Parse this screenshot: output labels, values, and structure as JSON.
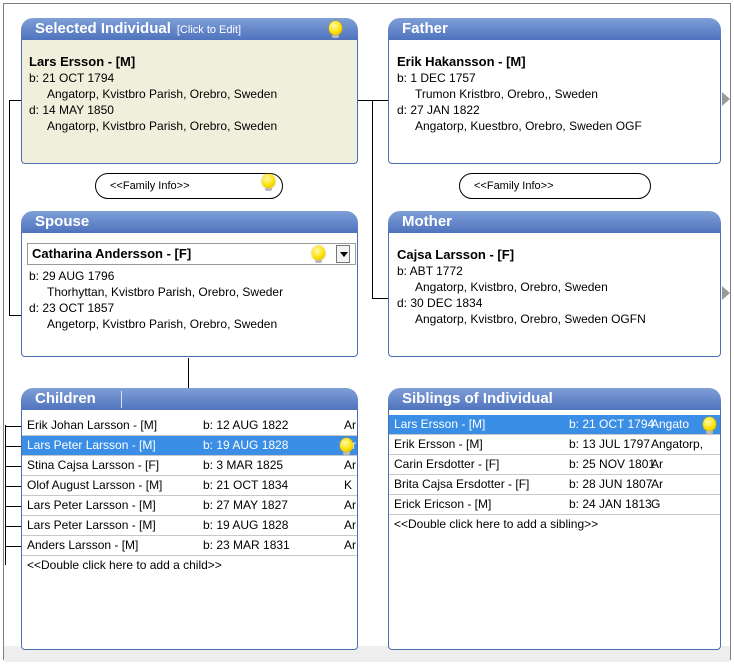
{
  "selected": {
    "title": "Selected Individual",
    "edit_label": "[Click to Edit]",
    "name": "Lars Ersson - [M]",
    "birth": "b: 21 OCT 1794",
    "birth_place": "Angatorp, Kvistbro Parish, Orebro, Sweden",
    "death": "d: 14 MAY 1850",
    "death_place": "Angatorp, Kvistbro Parish, Orebro, Sweden"
  },
  "father": {
    "title": "Father",
    "name": "Erik Hakansson - [M]",
    "birth": "b: 1 DEC 1757",
    "birth_place": "Trumon Kristbro, Orebro,, Sweden",
    "death": "d: 27 JAN 1822",
    "death_place": "Angatorp, Kuestbro, Orebro, Sweden   OGF"
  },
  "family_info_left": "<<Family Info>>",
  "family_info_right": "<<Family Info>>",
  "spouse": {
    "title": "Spouse",
    "name": "Catharina Andersson - [F]",
    "birth": "b: 29 AUG 1796",
    "birth_place": "Thorhyttan, Kvistbro Parish, Orebro, Sweder",
    "death": "d: 23 OCT 1857",
    "death_place": "Angetorp, Kvistbro Parish, Orebro, Sweden"
  },
  "mother": {
    "title": "Mother",
    "name": "Cajsa Larsson - [F]",
    "birth": "b: ABT 1772",
    "birth_place": "Angatorp, Kvistbro, Orebro, Sweden",
    "death": "d: 30 DEC 1834",
    "death_place": "Angatorp, Kvistbro, Orebro, Sweden   OGFN"
  },
  "children": {
    "title": "Children",
    "rows": [
      {
        "name": "Erik Johan Larsson - [M]",
        "birth": "b: 12 AUG 1822",
        "place": "Ar"
      },
      {
        "name": "Lars Peter Larsson - [M]",
        "birth": "b: 19 AUG 1828",
        "place": "Ar"
      },
      {
        "name": "Stina Cajsa Larsson - [F]",
        "birth": "b: 3 MAR 1825",
        "place": "Ar"
      },
      {
        "name": "Olof August Larsson - [M]",
        "birth": "b: 21 OCT 1834",
        "place": "K"
      },
      {
        "name": "Lars Peter Larsson - [M]",
        "birth": "b: 27 MAY 1827",
        "place": "Ar"
      },
      {
        "name": "Lars Peter Larsson - [M]",
        "birth": "b: 19 AUG 1828",
        "place": "Ar"
      },
      {
        "name": "Anders Larsson - [M]",
        "birth": "b: 23 MAR 1831",
        "place": "Ar"
      }
    ],
    "add_label": "<<Double click here to add a child>>"
  },
  "siblings": {
    "title": "Siblings of Individual",
    "rows": [
      {
        "name": "Lars Ersson - [M]",
        "birth": "b: 21 OCT 1794",
        "place": "Angato"
      },
      {
        "name": "Erik Ersson - [M]",
        "birth": "b: 13 JUL 1797",
        "place": "Angatorp,"
      },
      {
        "name": "Carin Ersdotter - [F]",
        "birth": "b: 25 NOV 1801",
        "place": "Ar"
      },
      {
        "name": "Brita Cajsa Ersdotter - [F]",
        "birth": "b: 28 JUN 1807",
        "place": "Ar"
      },
      {
        "name": "Erick Ericson - [M]",
        "birth": "b: 24 JAN 1813",
        "place": "G"
      }
    ],
    "add_label": "<<Double click here to add a sibling>>"
  },
  "colors": {
    "header": "#4f73bd",
    "selected_row": "#3a8ee6",
    "selected_box": "#f0efdc"
  }
}
